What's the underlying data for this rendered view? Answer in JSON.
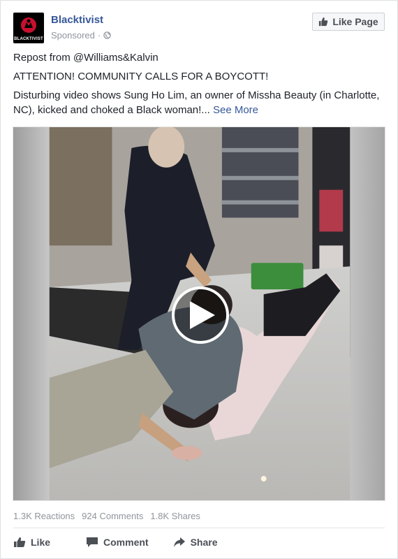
{
  "post": {
    "page_name": "Blacktivist",
    "logo_text": "BLACKTIVIST",
    "sponsored": "Sponsored",
    "sponsored_sep": "·",
    "like_page_label": "Like Page",
    "repost_line": "Repost from @Williams&Kalvin",
    "headline": "ATTENTION! COMMUNITY CALLS FOR A BOYCOTT!",
    "body": "Disturbing video shows Sung Ho Lim, an owner of Missha Beauty (in Charlotte, NC), kicked and choked a Black woman!...",
    "see_more": "See More"
  },
  "stats": {
    "reactions": "1.3K Reactions",
    "comments": "924 Comments",
    "shares": "1.8K Shares"
  },
  "actions": {
    "like": "Like",
    "comment": "Comment",
    "share": "Share"
  },
  "colors": {
    "link_blue": "#365899",
    "meta_gray": "#90949c",
    "action_gray": "#4b4f56"
  },
  "icons": {
    "avatar_logo": "blacktivist-logo",
    "globe": "globe-icon",
    "thumbs_up": "thumbs-up-icon",
    "comment": "comment-icon",
    "share": "share-icon",
    "play": "play-icon"
  }
}
